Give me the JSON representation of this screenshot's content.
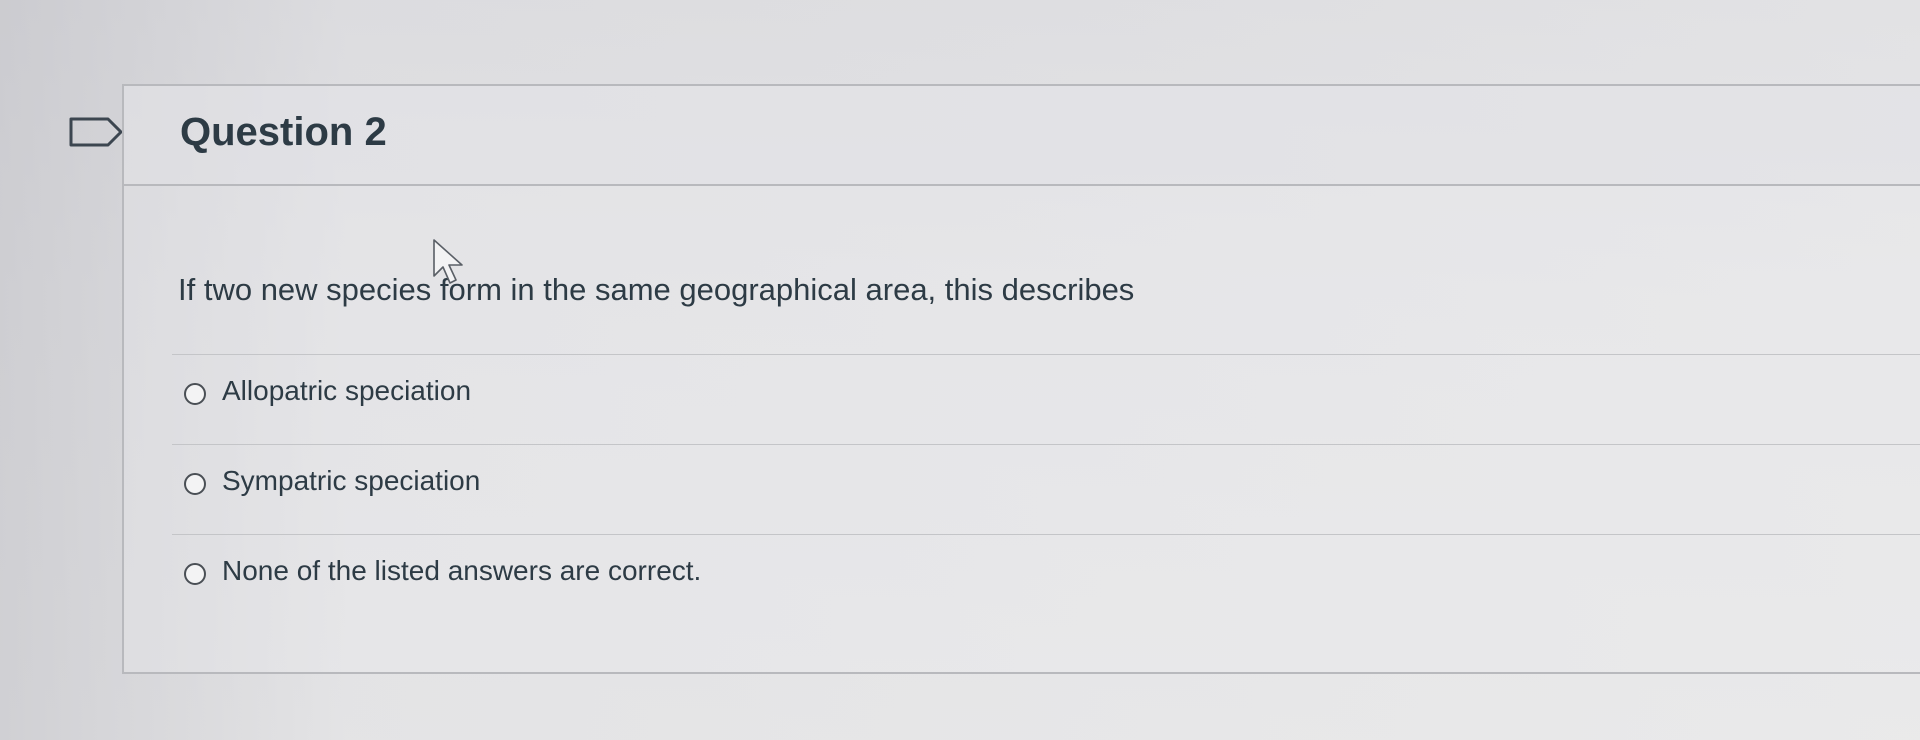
{
  "question": {
    "title": "Question 2",
    "text": "If two new species form in the same geographical area, this describes"
  },
  "answers": [
    {
      "label": "Allopatric speciation",
      "selected": false
    },
    {
      "label": "Sympatric speciation",
      "selected": false
    },
    {
      "label": "None of the listed answers are correct.",
      "selected": false
    }
  ],
  "icons": {
    "flag": "flag-icon",
    "cursor": "mouse-cursor-icon"
  },
  "colors": {
    "text": "#2d3b45",
    "border": "#b8b9bd"
  }
}
